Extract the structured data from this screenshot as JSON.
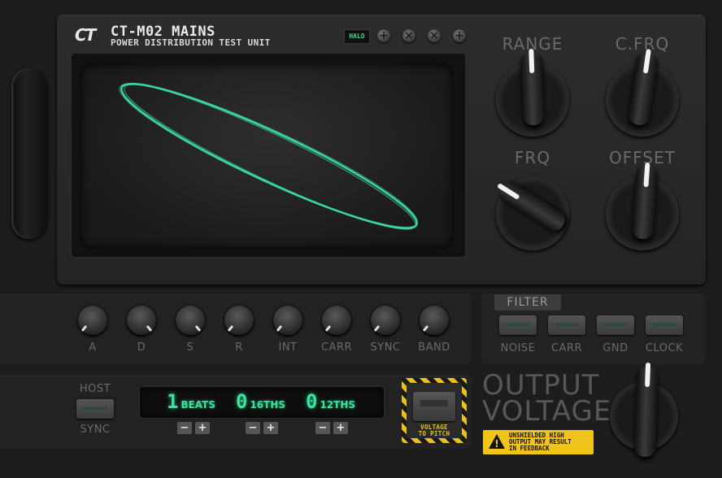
{
  "header": {
    "logo_text": "CT",
    "title": "CT-M02 MAINS",
    "subtitle": "POWER DISTRIBUTION TEST UNIT",
    "badge": "HALO"
  },
  "knobs": {
    "range": "RANGE",
    "cfrq": "C.FRQ",
    "frq": "FRQ",
    "offset": "OFFSET"
  },
  "small_knobs": [
    "A",
    "D",
    "S",
    "R",
    "INT",
    "CARR",
    "SYNC",
    "BAND"
  ],
  "filter": {
    "title": "FILTER",
    "buttons": [
      "NOISE",
      "CARR",
      "GND",
      "CLOCK"
    ]
  },
  "sequencer": {
    "host_label": "HOST",
    "sync_label": "SYNC",
    "fields": [
      {
        "value": "1",
        "unit": "BEATS"
      },
      {
        "value": "0",
        "unit": "16THS"
      },
      {
        "value": "0",
        "unit": "12THS"
      }
    ],
    "minus": "−",
    "plus": "+"
  },
  "voltage_to_pitch": {
    "line1": "VOLTAGE",
    "line2": "TO PITCH"
  },
  "output": {
    "line1": "OUTPUT",
    "line2": "VOLTAGE",
    "warning_line1": "UNSHIELDED HIGH",
    "warning_line2": "OUTPUT MAY RESULT",
    "warning_line3": "IN FEEDBACK",
    "warning_icon": "!"
  },
  "colors": {
    "trace": "#3de0a6",
    "lcd": "#39e3a0",
    "warning": "#f0c419"
  }
}
